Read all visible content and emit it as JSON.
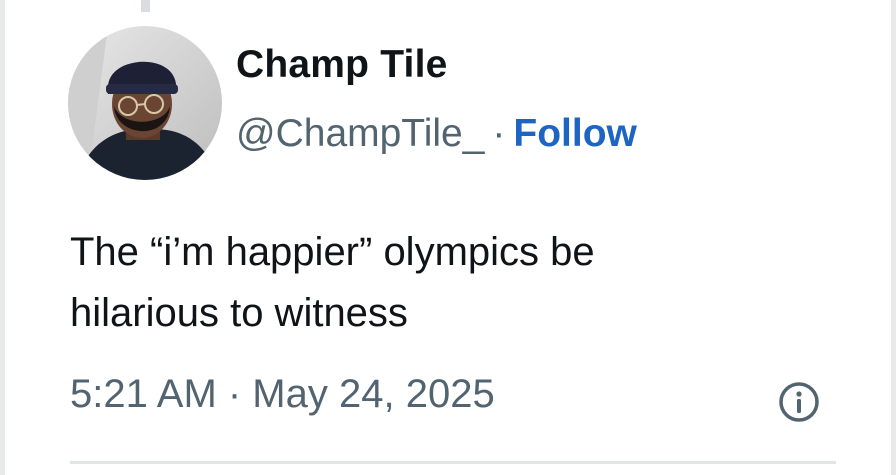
{
  "author": {
    "display_name": "Champ Tile",
    "handle": "@ChampTile_",
    "separator": "·",
    "follow_label": "Follow",
    "avatar_icon": "profile-photo"
  },
  "tweet": {
    "text_lines": [
      "The “i’m happier” olympics be",
      "hilarious to witness"
    ],
    "timestamp": "5:21 AM · May 24, 2025",
    "info_icon": "info-circle-icon"
  },
  "colors": {
    "follow_link": "#1d64c3",
    "secondary_text": "#536471",
    "primary_text": "#0f1419",
    "divider": "#e1e5e8"
  }
}
